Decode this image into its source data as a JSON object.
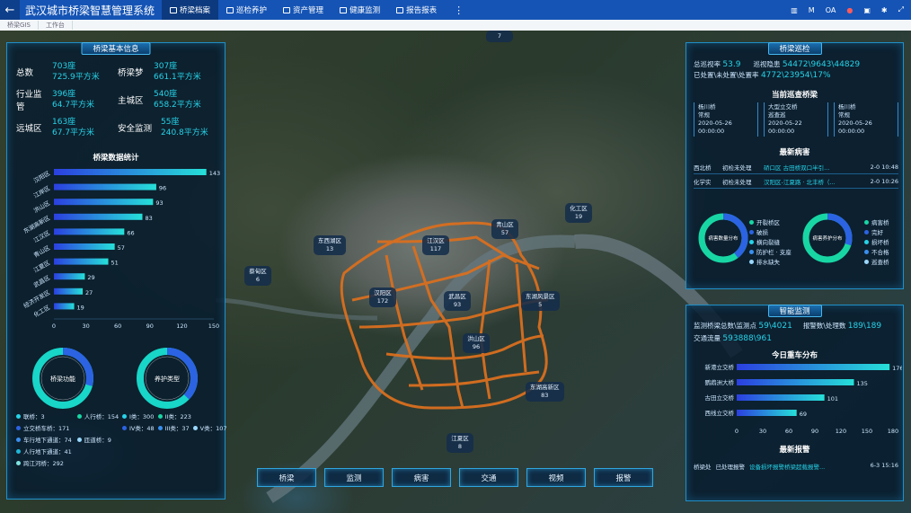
{
  "topbar": {
    "title": "武汉城市桥梁智慧管理系统",
    "nav": [
      "桥梁档案",
      "巡检养护",
      "资产管理",
      "健康监测",
      "报告报表"
    ],
    "right": [
      "M",
      "OA"
    ]
  },
  "tabs": [
    "桥梁GIS",
    "工作台"
  ],
  "left": {
    "title": "桥梁基本信息",
    "stats": [
      {
        "label": "总数",
        "v1": "703座",
        "v2": "725.9平方米"
      },
      {
        "label": "桥梁梦",
        "v1": "307座",
        "v2": "661.1平方米"
      },
      {
        "label": "行业监管",
        "v1": "396座",
        "v2": "64.7平方米"
      },
      {
        "label": "主城区",
        "v1": "540座",
        "v2": "658.2平方米"
      },
      {
        "label": "远城区",
        "v1": "163座",
        "v2": "67.7平方米"
      },
      {
        "label": "安全监测",
        "v1": "55座",
        "v2": "240.8平方米"
      }
    ],
    "chart_title": "桥梁数据统计",
    "donut1_label": "桥梁功能",
    "donut2_label": "养护类型",
    "legend1": [
      "联桥：3",
      "人行桥：154",
      "立交桥车桥：171",
      "车行地下通道：74",
      "匝道桥：9",
      "人行地下通道：41",
      "跨江河桥：292"
    ],
    "legend2": [
      "I类：300",
      "II类：223",
      "IV类：48",
      "III类：37",
      "V类：107"
    ]
  },
  "chart_data": {
    "type": "bar",
    "categories": [
      "汉阳区",
      "江岸区",
      "洪山区",
      "东湖高新区",
      "江汉区",
      "青山区",
      "江夏区",
      "武昌区",
      "经济开发区",
      "化工区"
    ],
    "values": [
      143,
      96,
      93,
      83,
      66,
      57,
      51,
      29,
      27,
      19
    ],
    "xlim": [
      0,
      150
    ],
    "ticks": [
      0,
      30,
      60,
      90,
      120,
      150
    ]
  },
  "map": {
    "districts": [
      {
        "name": "东西湖区",
        "n": "13"
      },
      {
        "name": "江汉区",
        "n": "117"
      },
      {
        "name": "青山区",
        "n": "57"
      },
      {
        "name": "化工区",
        "n": "19"
      },
      {
        "name": "蔡甸区",
        "n": "6"
      },
      {
        "name": "汉阳区",
        "n": "172"
      },
      {
        "name": "武昌区",
        "n": "93"
      },
      {
        "name": "东湖风景区",
        "n": "5"
      },
      {
        "name": "洪山区",
        "n": "96"
      },
      {
        "name": "东湖高新区",
        "n": "83"
      },
      {
        "name": "江夏区",
        "n": "8"
      },
      {
        "name": "",
        "n": "7"
      }
    ],
    "buttons": [
      "桥梁",
      "监测",
      "病害",
      "交通",
      "视频",
      "报警"
    ]
  },
  "right": {
    "patrol_title": "桥梁巡检",
    "patrol_stats": [
      {
        "label": "总巡视率",
        "value": "53.9"
      },
      {
        "label": "巡视隐患",
        "value": "54472\\9643\\44829"
      },
      {
        "label": "已处置\\未处置\\处置率",
        "value": "4772\\23954\\17%"
      }
    ],
    "current_title": "当前巡查桥梁",
    "current": [
      {
        "name": "杨川桥",
        "type": "常规",
        "date": "2020-05-26",
        "time": "00:00:00"
      },
      {
        "name": "大型立交桥",
        "type": "巡查巡",
        "date": "2020-05-22",
        "time": "00:00:00"
      },
      {
        "name": "杨川桥",
        "type": "常规",
        "date": "2020-05-26",
        "time": "00:00:00"
      }
    ],
    "disease_title": "最新病害",
    "diseases": [
      {
        "a": "西北桥",
        "b": "初检未处理",
        "c": "硚口区 古田桥双口半引...",
        "d": "2-0 10:48"
      },
      {
        "a": "化学实",
        "b": "初检未处理",
        "c": "汉阳区-江夏路 · 北丰桥（...",
        "d": "2-0 10:26"
      }
    ],
    "d3": {
      "label": "病害数量分布"
    },
    "d4": {
      "label": "病害养护分布"
    },
    "leg3": [
      "开裂桥区",
      "破损",
      "横向裂缝",
      "防护栏 · 支座",
      "排水缺失"
    ],
    "leg4": [
      "病害桥",
      "完好",
      "损坏桥",
      "不合格",
      "巡查桥"
    ],
    "monitor_title": "智能监测",
    "monitor_stats": [
      {
        "label": "监测桥梁总数\\监测点",
        "value": "59\\4021"
      },
      {
        "label": "报警数\\处理数",
        "value": "189\\189"
      },
      {
        "label": "交通流量",
        "value": "593888\\961"
      }
    ],
    "truck_title": "今日重车分布",
    "trucks": {
      "categories": [
        "新港立交桥",
        "鹦鹉洲大桥",
        "古田立交桥",
        "西线立交桥"
      ],
      "values": [
        176,
        135,
        101,
        69
      ],
      "ticks": [
        0,
        30,
        60,
        90,
        120,
        150,
        180
      ]
    },
    "alarm_title": "最新报警",
    "alarm": {
      "a": "桥梁处",
      "b": "已处理报警",
      "c": "设备损坏报警桥梁超载报警...",
      "d": "6-3 15:16"
    }
  }
}
